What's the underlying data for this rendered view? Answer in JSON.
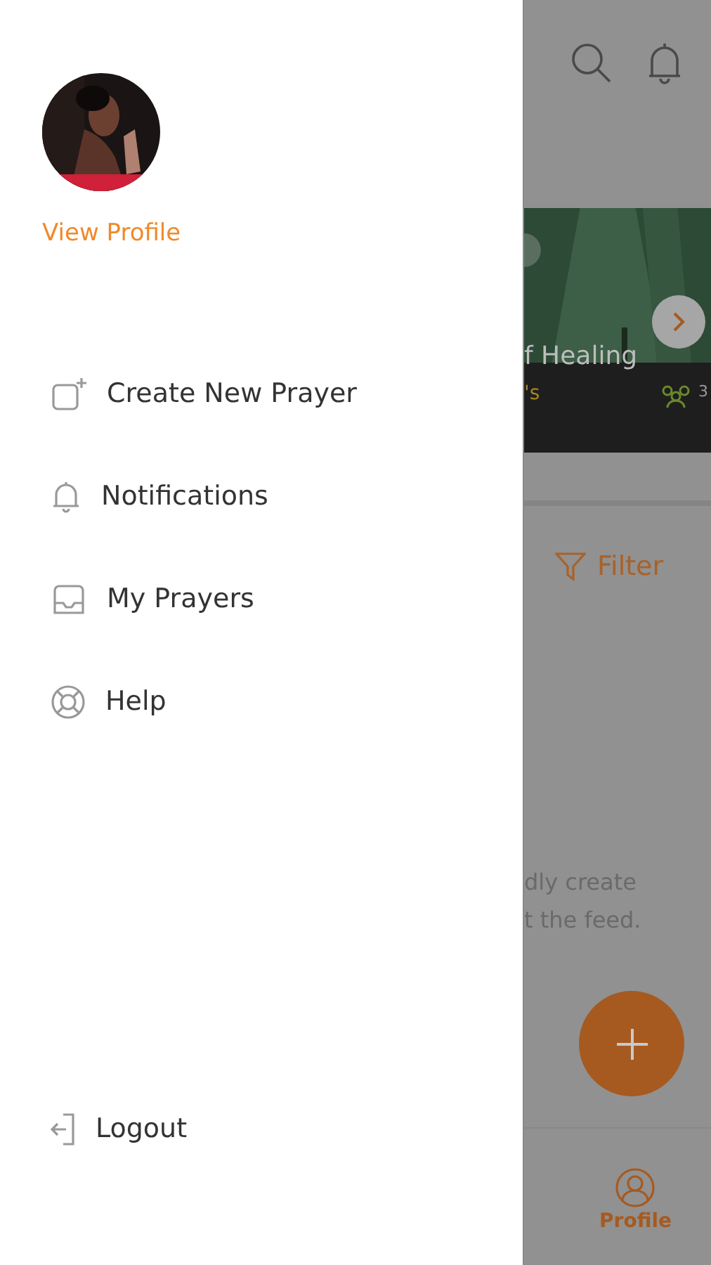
{
  "drawer": {
    "profile_link": "View Profile",
    "menu": [
      {
        "kind": "create",
        "label": "Create New Prayer"
      },
      {
        "kind": "bell",
        "label": "Notifications"
      },
      {
        "kind": "inbox",
        "label": "My Prayers"
      },
      {
        "kind": "help",
        "label": "Help"
      }
    ],
    "logout": {
      "kind": "logout",
      "label": "Logout"
    }
  },
  "background": {
    "banner": {
      "title": "f Healing",
      "subtitle": "'s",
      "count": "3"
    },
    "filter": "Filter",
    "empty_message": [
      "dly create",
      "t the feed."
    ],
    "bottom_nav": [
      {
        "label": "Profile",
        "selected": true
      }
    ]
  }
}
